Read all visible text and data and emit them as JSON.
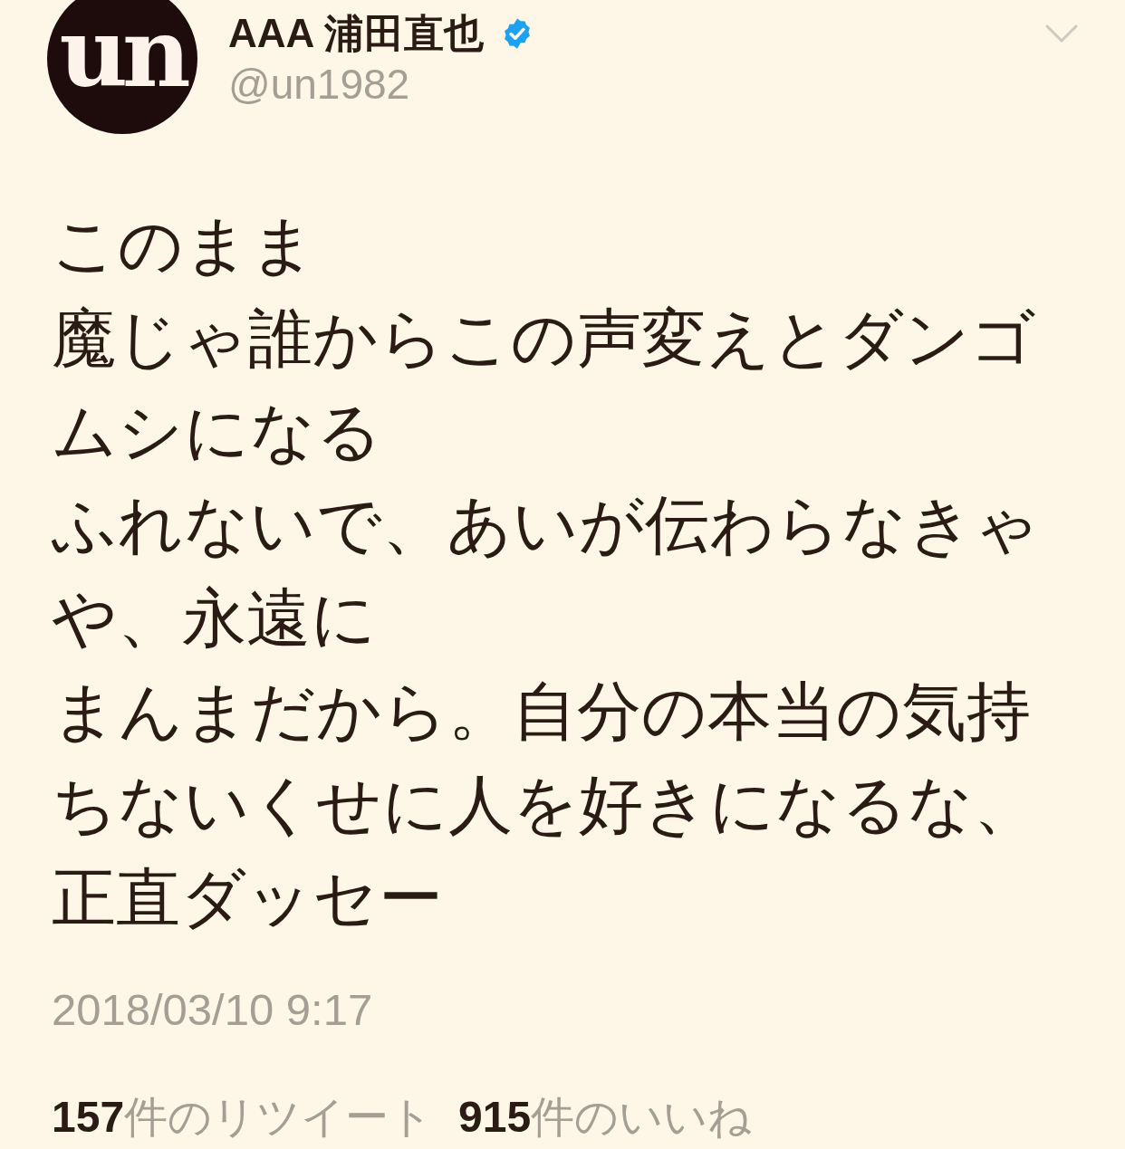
{
  "tweet": {
    "author": {
      "avatar_text": "un",
      "name": "AAA 浦田直也",
      "verified": true,
      "handle": "@un1982"
    },
    "text_lines": [
      "このまま",
      "魔じゃ誰からこの声変えとダンゴムシになる",
      "ふれないで、あいが伝わらなきゃや、永遠に",
      "まんまだから。自分の本当の気持ちないくせに人を好きになるな、",
      "正直ダッセー"
    ],
    "timestamp": "2018/03/10 9:17",
    "stats": [
      {
        "count": "157",
        "label": "件のリツイート"
      },
      {
        "count": "915",
        "label": "件のいいね"
      }
    ]
  }
}
